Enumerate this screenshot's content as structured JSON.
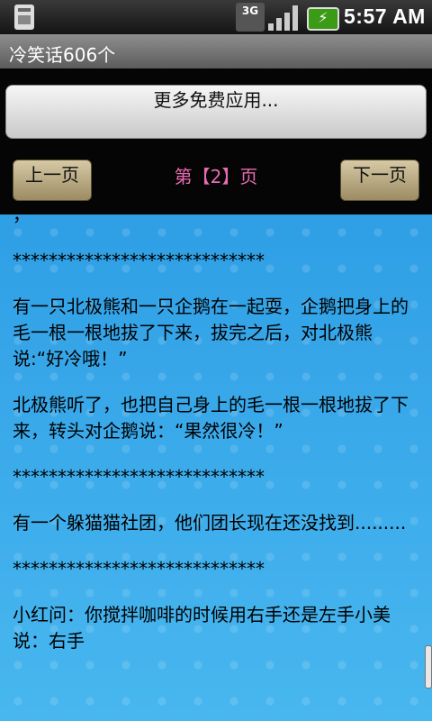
{
  "status_bar": {
    "network": "3G",
    "time": "5:57 AM",
    "icons": [
      "sd-card-icon",
      "3g-icon",
      "signal-icon",
      "battery-icon"
    ]
  },
  "app": {
    "title": "冷笑话606个"
  },
  "buttons": {
    "more_apps": "更多免费应用...",
    "prev": "上一页",
    "next": "下一页"
  },
  "page_indicator": "第【2】页",
  "content": {
    "paragraphs": [
      "，",
      "****************************",
      "有一只北极熊和一只企鹅在一起耍，企鹅把身上的毛一根一根地拔了下来，拔完之后，对北极熊说:“好冷哦！”",
      "北极熊听了，也把自己身上的毛一根一根地拔了下来，转头对企鹅说：“果然很冷！”",
      "****************************",
      "有一个躲猫猫社团，他们团长现在还没找到.........",
      "****************************",
      "小红问：你搅拌咖啡的时候用右手还是左手小美说：右手"
    ]
  },
  "colors": {
    "content_bg": "#35a6e9",
    "page_indicator": "#e86ab0",
    "nav_button": "#b8aa80"
  }
}
